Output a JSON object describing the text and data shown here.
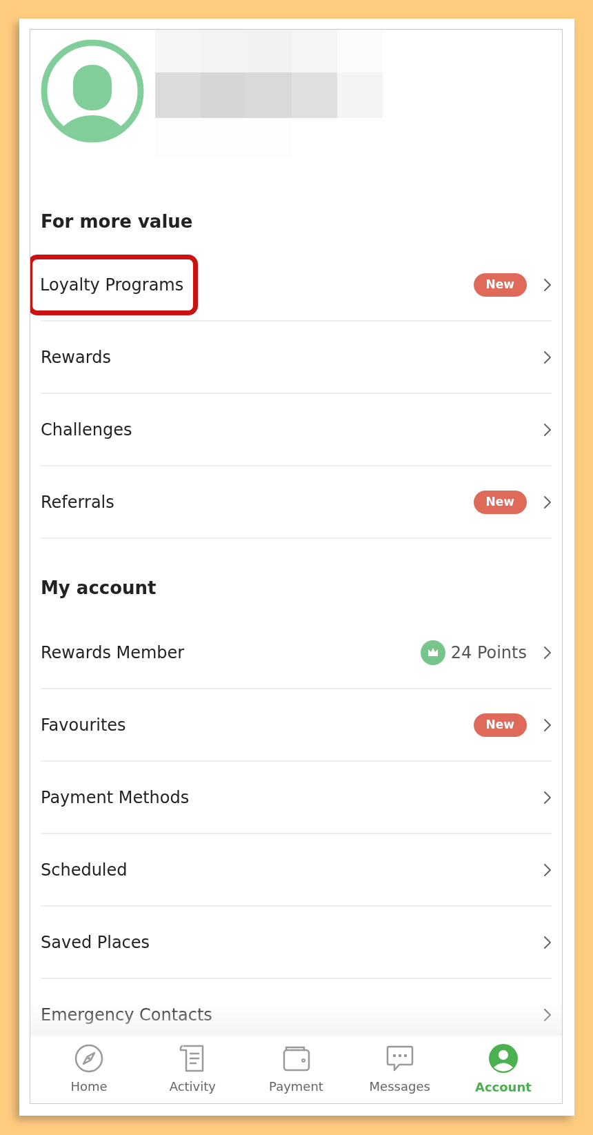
{
  "sections": [
    {
      "title": "For more value",
      "items": [
        {
          "label": "Loyalty Programs",
          "highlighted": true,
          "badge": "New"
        },
        {
          "label": "Rewards",
          "highlighted": false
        },
        {
          "label": "Challenges",
          "highlighted": false
        },
        {
          "label": "Referrals",
          "highlighted": false,
          "badge": "New"
        }
      ]
    },
    {
      "title": "My account",
      "items": [
        {
          "label": "Rewards Member",
          "highlighted": false,
          "points": "24 Points"
        },
        {
          "label": "Favourites",
          "highlighted": false,
          "badge": "New"
        },
        {
          "label": "Payment Methods",
          "highlighted": false
        },
        {
          "label": "Scheduled",
          "highlighted": false
        },
        {
          "label": "Saved Places",
          "highlighted": false
        },
        {
          "label": "Emergency Contacts",
          "highlighted": false
        }
      ]
    }
  ],
  "nav": [
    {
      "label": "Home",
      "selected": false
    },
    {
      "label": "Activity",
      "selected": false
    },
    {
      "label": "Payment",
      "selected": false
    },
    {
      "label": "Messages",
      "selected": false
    },
    {
      "label": "Account",
      "selected": true
    }
  ]
}
